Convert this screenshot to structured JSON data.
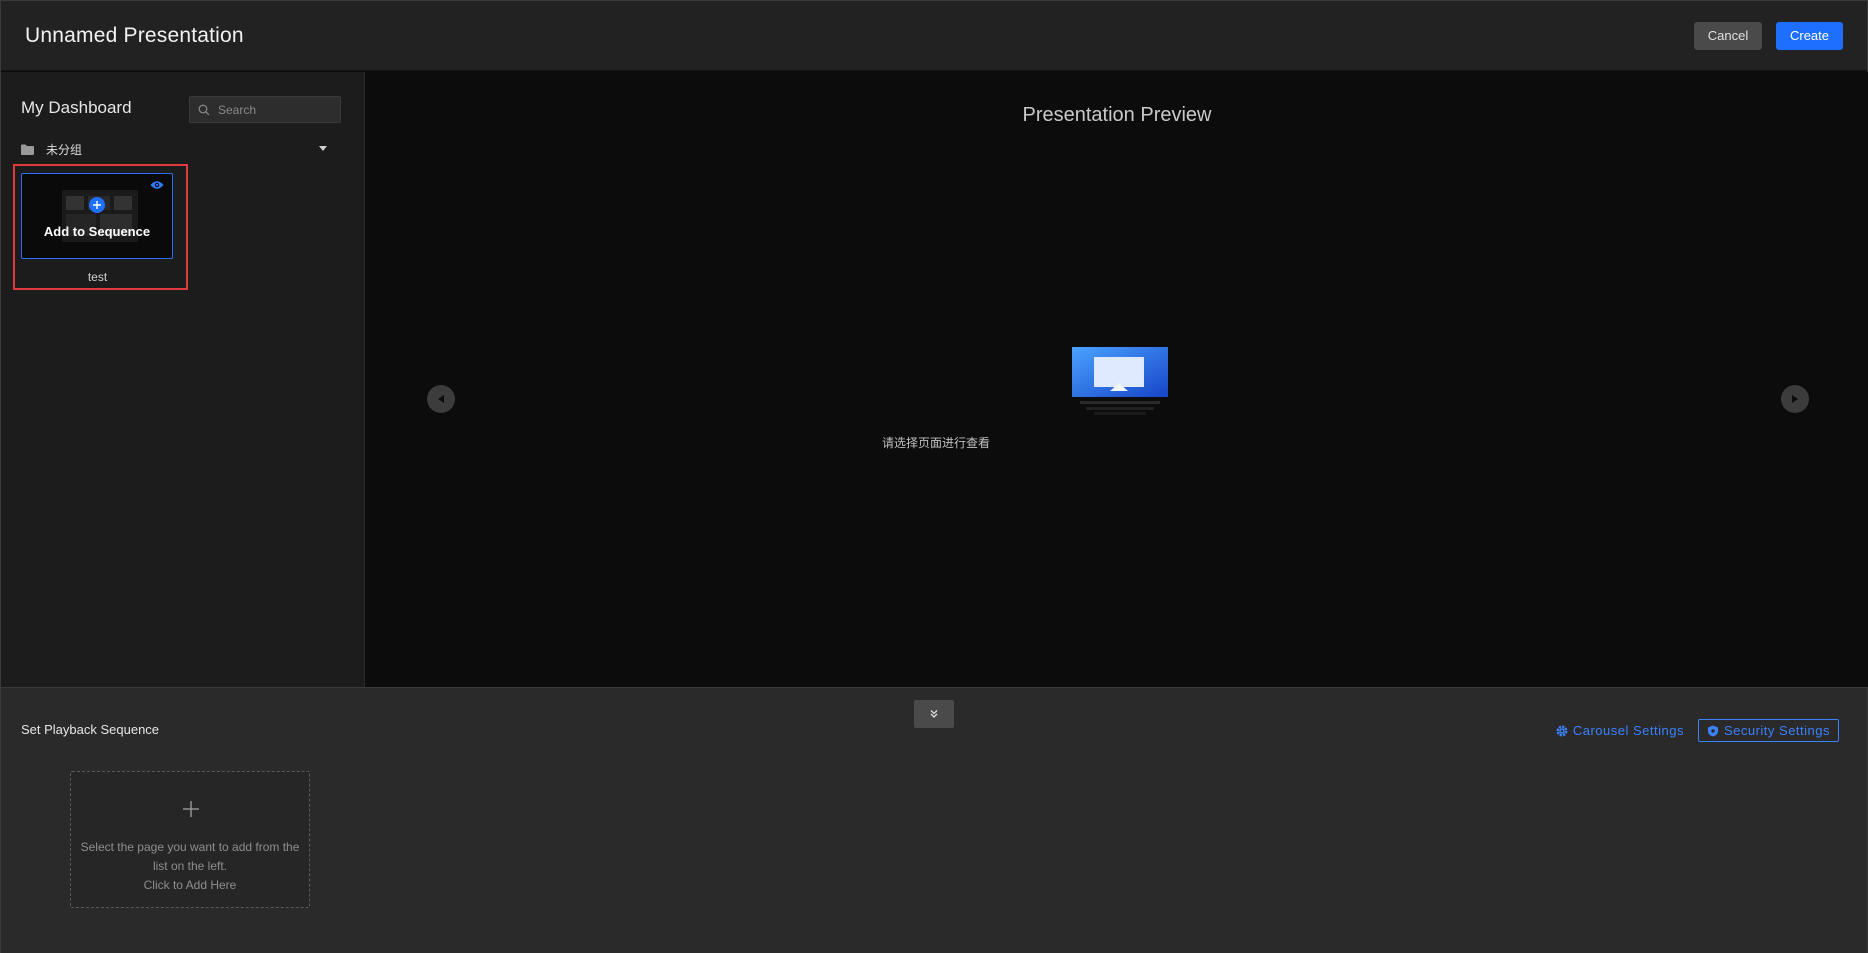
{
  "header": {
    "title": "Unnamed Presentation",
    "cancel_label": "Cancel",
    "create_label": "Create"
  },
  "sidebar": {
    "title": "My Dashboard",
    "search_placeholder": "Search",
    "group": {
      "label": "未分组"
    },
    "card": {
      "overlay_label": "Add to Sequence",
      "name": "test"
    }
  },
  "preview": {
    "title": "Presentation Preview",
    "empty_text": "请选择页面进行查看"
  },
  "bottom": {
    "title": "Set Playback Sequence",
    "carousel_settings_label": "Carousel Settings",
    "security_settings_label": "Security Settings",
    "add_slot": {
      "line1": "Select the page you want to add from the list on the left.",
      "line2": "Click to Add Here"
    }
  },
  "colors": {
    "accent": "#1f6fff",
    "link": "#3b82ff",
    "highlight_border": "#e0393e"
  },
  "icons": [
    "search-icon",
    "folder-icon",
    "caret-down-icon",
    "add-circle-icon",
    "eye-icon",
    "arrow-left-icon",
    "arrow-right-icon",
    "monitor-icon",
    "chevrons-down-icon",
    "gear-icon",
    "shield-gear-icon",
    "plus-icon"
  ]
}
